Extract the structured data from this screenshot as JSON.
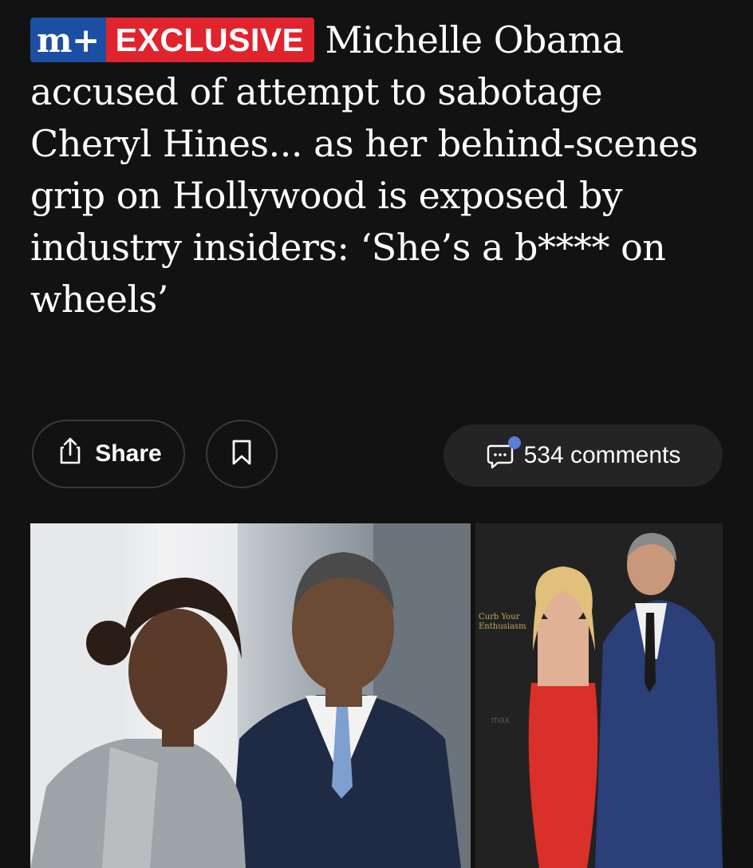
{
  "headline": {
    "badge_logo": "m+",
    "badge_label": "EXCLUSIVE",
    "text": "Michelle Obama accused of attempt to sabotage Cheryl Hines... as her behind-scenes grip on Hollywood is exposed by industry insiders: ‘She’s a b**** on wheels’"
  },
  "actions": {
    "share_label": "Share",
    "comments_label": "534 comments"
  },
  "colors": {
    "background": "#121212",
    "badge_blue": "#1c4fa3",
    "badge_red": "#e0242e",
    "notification_dot": "#5b7fd6"
  },
  "icons": [
    "share-icon",
    "bookmark-icon",
    "comment-icon"
  ]
}
